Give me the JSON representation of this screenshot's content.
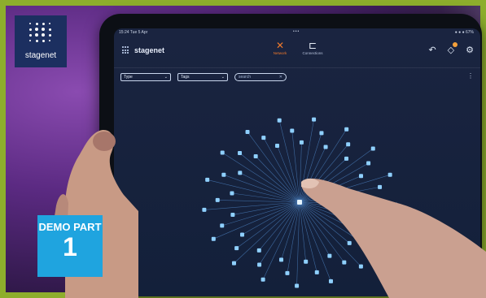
{
  "status": {
    "time": "15:24  Tue 5 Apr",
    "right": "● ● ● 67%",
    "dots": "•••"
  },
  "brand": {
    "name": "stagenet"
  },
  "nav": [
    {
      "label": "Network",
      "icon": "network-icon"
    },
    {
      "label": "Connections",
      "icon": "connections-icon"
    }
  ],
  "toolbar_icons": [
    "undo-icon",
    "notification-icon",
    "settings-icon"
  ],
  "filters": {
    "type_label": "Type",
    "tags_label": "Tags",
    "search_placeholder": "search"
  },
  "logo": {
    "word": "stagenet"
  },
  "overlay": {
    "line1": "DEMO PART",
    "line2": "1"
  },
  "colors": {
    "frame": "#8dae2c",
    "accent": "#f07a2c",
    "badge": "#1fa4df",
    "node": "#8fd0ff",
    "edge": "#4f87c8"
  },
  "graph": {
    "node_count": 52
  }
}
